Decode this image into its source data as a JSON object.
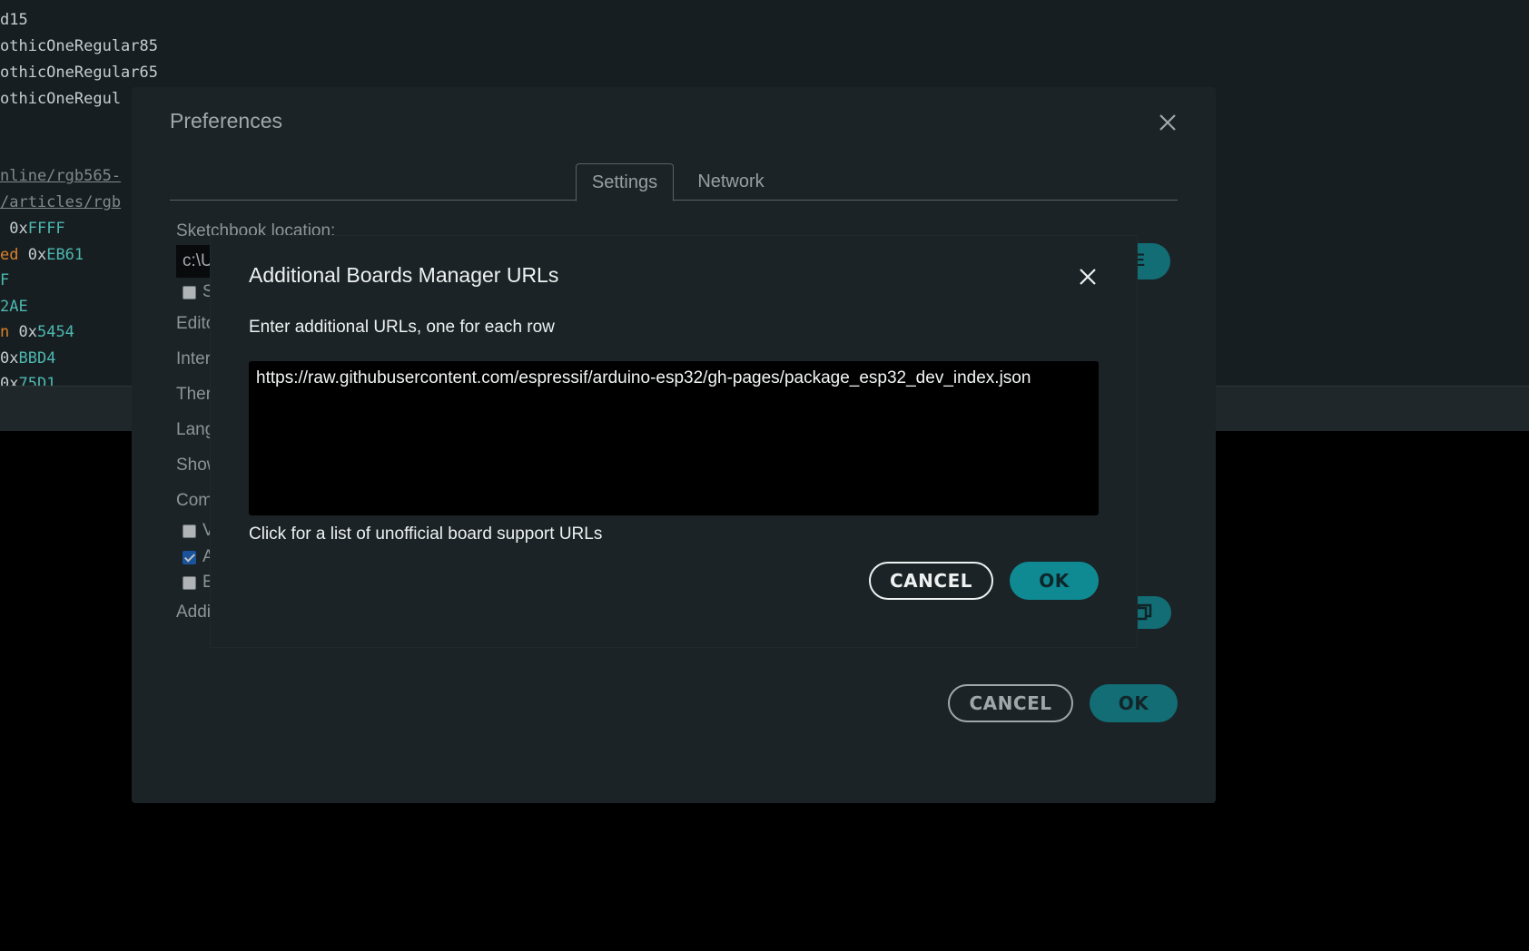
{
  "editor": {
    "lines": [
      {
        "t1": "d15",
        "kw": "",
        "hex": ""
      },
      {
        "t1": "othicOneRegular85",
        "kw": "",
        "hex": ""
      },
      {
        "t1": "othicOneRegular65",
        "kw": "",
        "hex": ""
      },
      {
        "t1": "othicOneRegul",
        "kw": "",
        "hex": ""
      },
      {
        "t1": "",
        "kw": "",
        "hex": ""
      },
      {
        "t1": "",
        "kw": "",
        "hex": ""
      },
      {
        "t1": "nline/rgb565-",
        "kw": "",
        "hex": "",
        "muted": true
      },
      {
        "t1": "/articles/rgb",
        "kw": "",
        "hex": "",
        "muted": true
      },
      {
        "t1": " 0x",
        "kw": "",
        "hex": "FFFF"
      },
      {
        "t1": " 0x",
        "kw": "ed",
        "hex": "EB61"
      },
      {
        "t1": "",
        "kw": "",
        "hex": "F"
      },
      {
        "t1": "",
        "kw": "",
        "hex": "2AE"
      },
      {
        "t1": " 0x",
        "kw": "n",
        "hex": "5454"
      },
      {
        "t1": "0x",
        "kw": "",
        "hex": "BBD4"
      },
      {
        "t1": "0x",
        "kw": "",
        "hex": "75D1"
      }
    ]
  },
  "preferences": {
    "title": "Preferences",
    "tabs": [
      {
        "label": "Settings",
        "active": true
      },
      {
        "label": "Network",
        "active": false
      }
    ],
    "sketchbook_label": "Sketchbook location:",
    "sketchbook_value": "c:\\U",
    "browse_label_fragment": "E",
    "partial_labels": [
      "Edito",
      "Inter",
      "Ther",
      "Lang",
      "Show",
      "Com",
      "Addi"
    ],
    "checkbox_letters": [
      "S",
      "V",
      "A",
      "E"
    ],
    "cancel_label": "CANCEL",
    "ok_label": "OK"
  },
  "boards_dialog": {
    "title": "Additional Boards Manager URLs",
    "instruction": "Enter additional URLs, one for each row",
    "urls_value": "https://raw.githubusercontent.com/espressif/arduino-esp32/gh-pages/package_esp32_dev_index.json",
    "link_text": "Click for a list of unofficial board support URLs",
    "cancel_label": "CANCEL",
    "ok_label": "OK"
  },
  "colors": {
    "accent": "#0f8a93",
    "dialog_bg": "#1b2326",
    "checkbox_checked": "#1a66c9"
  }
}
